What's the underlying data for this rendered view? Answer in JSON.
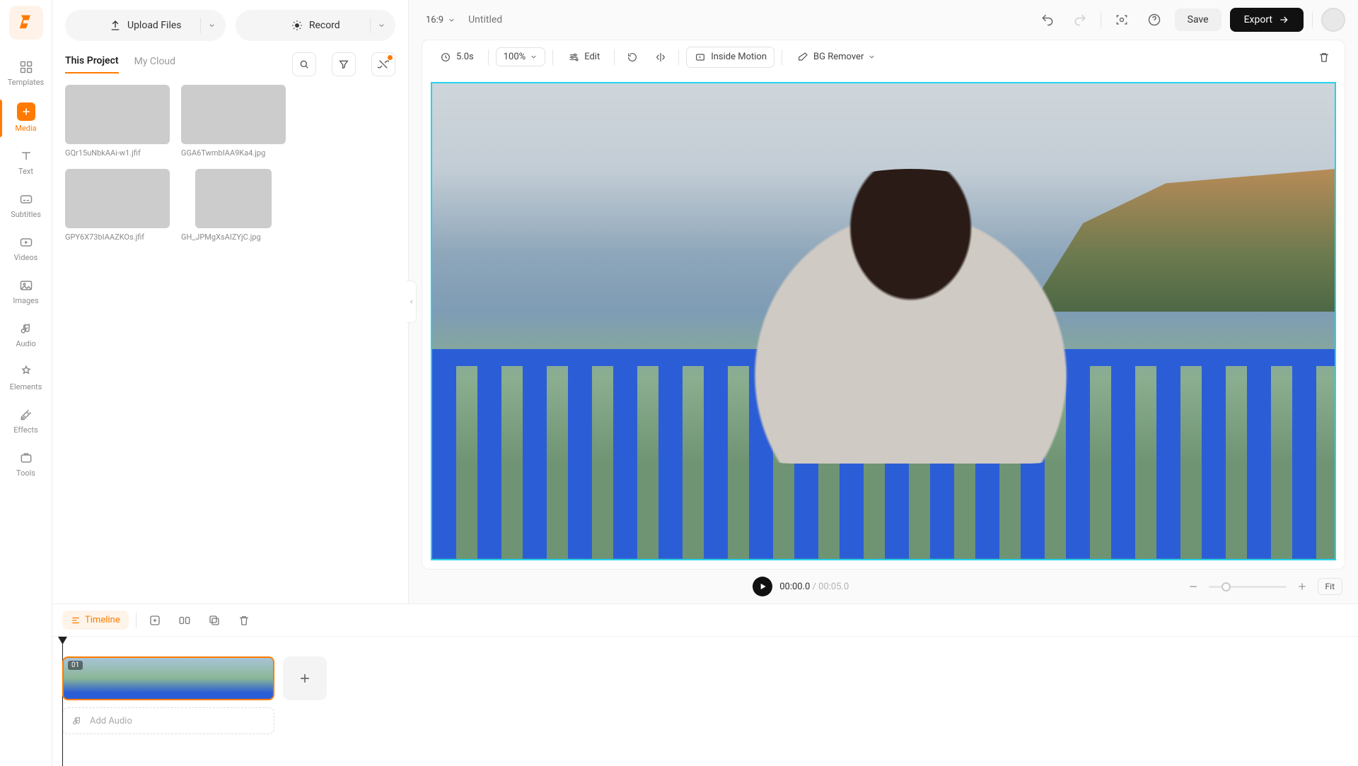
{
  "nav": {
    "items": [
      {
        "label": "Templates"
      },
      {
        "label": "Media"
      },
      {
        "label": "Text"
      },
      {
        "label": "Subtitles"
      },
      {
        "label": "Videos"
      },
      {
        "label": "Images"
      },
      {
        "label": "Audio"
      },
      {
        "label": "Elements"
      },
      {
        "label": "Effects"
      },
      {
        "label": "Tools"
      }
    ]
  },
  "media": {
    "upload_label": "Upload Files",
    "record_label": "Record",
    "tabs": {
      "this_project": "This Project",
      "my_cloud": "My Cloud"
    },
    "files": [
      {
        "name": "GQr15uNbkAAi-w1.jfif"
      },
      {
        "name": "GGA6TwmbIAA9Ka4.jpg"
      },
      {
        "name": "GPY6X73bIAAZKOs.jfif"
      },
      {
        "name": "GH_JPMgXsAIZYjC.jpg"
      }
    ]
  },
  "header": {
    "ratio": "16:9",
    "title_placeholder": "Untitled",
    "save": "Save",
    "export": "Export"
  },
  "toolbar": {
    "duration": "5.0s",
    "zoom": "100%",
    "edit": "Edit",
    "inside_motion": "Inside Motion",
    "bg_remover": "BG Remover"
  },
  "player": {
    "current": "00:00.0",
    "total": "00:05.0",
    "fit": "Fit"
  },
  "timeline": {
    "label": "Timeline",
    "clip_badge": "01",
    "add_audio": "Add Audio"
  }
}
